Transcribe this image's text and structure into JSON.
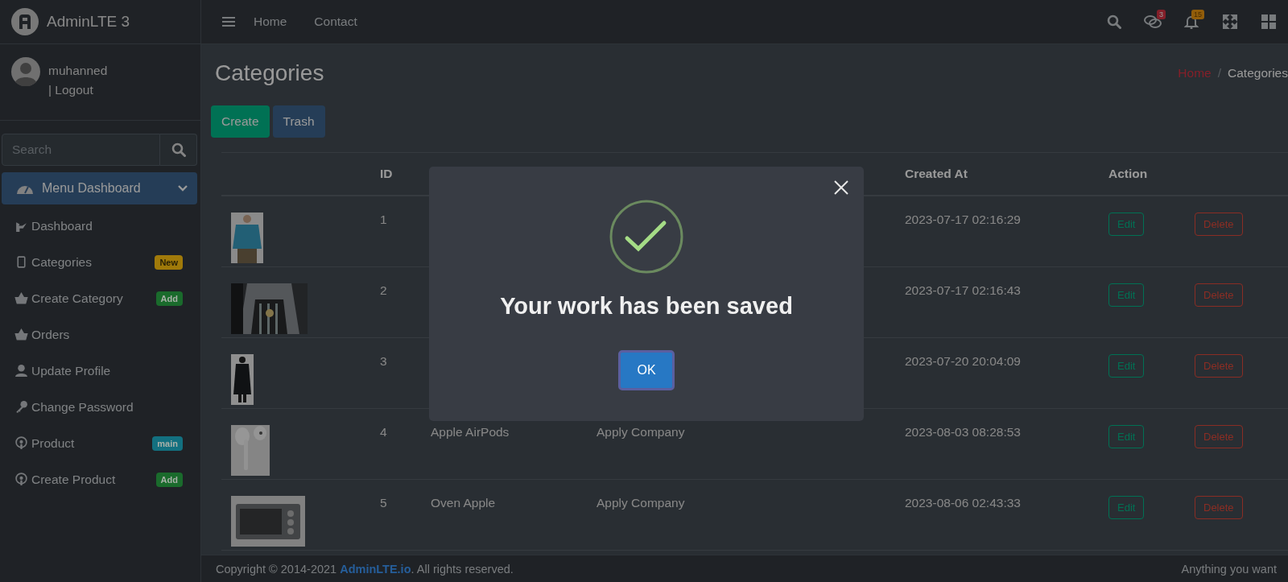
{
  "brand": {
    "name": "AdminLTE 3"
  },
  "user": {
    "name": "muhanned",
    "logout": "| Logout"
  },
  "sidebar_search": {
    "placeholder": "Search"
  },
  "menu_header": {
    "label": "Menu Dashboard",
    "expanded": true
  },
  "sidebar": {
    "items": [
      {
        "label": "Dashboard"
      },
      {
        "label": "Categories",
        "badge": "New",
        "color": "#a07a0a"
      },
      {
        "label": "Create Category",
        "badge": "Add",
        "color": "#1a6b2c"
      },
      {
        "label": "Orders"
      },
      {
        "label": "Update Profile"
      },
      {
        "label": "Change Password"
      },
      {
        "label": "Product",
        "badge": "main",
        "color": "#137080"
      },
      {
        "label": "Create Product",
        "badge": "Add",
        "color": "#1a6b2c"
      }
    ]
  },
  "navbar": {
    "links": [
      "Home",
      "Contact"
    ],
    "message_count": "3",
    "notification_count": "15"
  },
  "page": {
    "title": "Categories",
    "breadcrumb": [
      {
        "label": "Home",
        "selected": false
      },
      {
        "label": "Categories",
        "selected": true
      }
    ],
    "breadcrumb_separator": "/",
    "buttons": [
      "Create",
      "Trash"
    ]
  },
  "table": {
    "columns": {
      "id": "ID",
      "created": "Created At",
      "action": "Action"
    },
    "rows": [
      {
        "id": "1",
        "created": "2023-07-17 02:16:29",
        "edit": "Edit",
        "delete": "Delete"
      },
      {
        "id": "2",
        "created": "2023-07-17 02:16:43",
        "edit": "Edit",
        "delete": "Delete"
      },
      {
        "id": "3",
        "created": "2023-07-20 20:04:09",
        "edit": "Edit",
        "delete": "Delete"
      },
      {
        "id": "4",
        "name": "Apple AirPods",
        "parent": "Apply Company",
        "created": "2023-08-03 08:28:53",
        "edit": "Edit",
        "delete": "Delete"
      },
      {
        "id": "5",
        "name": "Oven Apple",
        "parent": "Apply Company",
        "created": "2023-08-06 02:43:33",
        "edit": "Edit",
        "delete": "Delete"
      }
    ]
  },
  "footer": {
    "copyright": "Copyright © 2014-2021 ",
    "link": "AdminLTE.io",
    "rest": ". All rights reserved.",
    "right": "Anything you want"
  },
  "modal": {
    "title": "Your work has been saved",
    "button": "OK"
  }
}
